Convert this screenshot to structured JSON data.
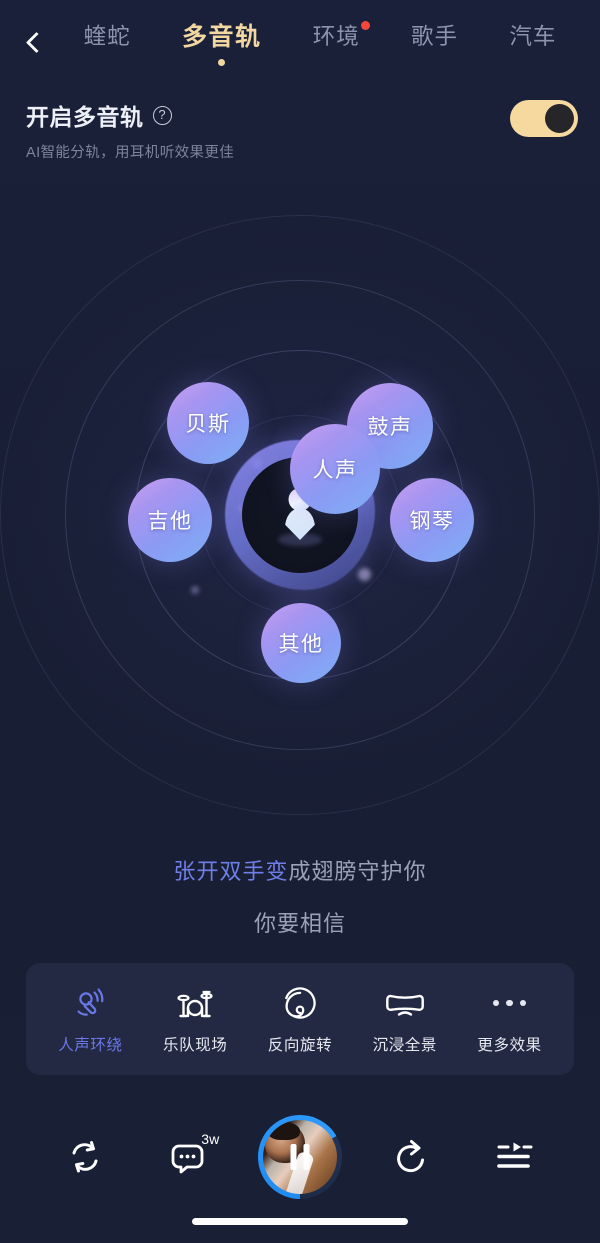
{
  "header": {
    "back_icon": "chevron-left-icon",
    "tabs": [
      {
        "label": "蝰蛇",
        "active": false,
        "badge": false
      },
      {
        "label": "多音轨",
        "active": true,
        "badge": false
      },
      {
        "label": "环境",
        "active": false,
        "badge": true
      },
      {
        "label": "歌手",
        "active": false,
        "badge": false
      },
      {
        "label": "汽车",
        "active": false,
        "badge": false
      }
    ],
    "active_color": "#f3d7a0",
    "inactive_color": "#8c93ad",
    "badge_color": "#f4473c"
  },
  "enable_section": {
    "title": "开启多音轨",
    "help_icon": "question-mark-icon",
    "help_glyph": "?",
    "subtitle": "AI智能分轨，用耳机听效果更佳",
    "toggle_on": true,
    "toggle_color": "#f5d99e"
  },
  "visualizer": {
    "center_avatar": "listener-avatar-icon",
    "tracks": [
      {
        "id": "bass",
        "label": "贝斯"
      },
      {
        "id": "drums",
        "label": "鼓声"
      },
      {
        "id": "vocal",
        "label": "人声"
      },
      {
        "id": "guitar",
        "label": "吉他"
      },
      {
        "id": "piano",
        "label": "钢琴"
      },
      {
        "id": "other",
        "label": "其他"
      }
    ],
    "bubble_color": "#8b9af4"
  },
  "lyrics": {
    "line1_highlighted": "张开双手变",
    "line1_rest": "成翅膀守护你",
    "line2": "你要相信",
    "highlight_color": "#6f7fe8",
    "dim_color": "#9ba2b8"
  },
  "effects": {
    "items": [
      {
        "label": "人声环绕",
        "icon": "microphone-surround-icon",
        "active": true
      },
      {
        "label": "乐队现场",
        "icon": "drum-kit-icon",
        "active": false
      },
      {
        "label": "反向旋转",
        "icon": "spiral-icon",
        "active": false
      },
      {
        "label": "沉浸全景",
        "icon": "vr-headset-icon",
        "active": false
      },
      {
        "label": "更多效果",
        "icon": "more-dots-icon",
        "active": false
      }
    ],
    "active_color": "#6a77e6",
    "panel_color": "#232943"
  },
  "player_bar": {
    "loop_icon": "repeat-icon",
    "comment_icon": "comment-icon",
    "comment_count": "3w",
    "album_icon": "album-art-play-toggle",
    "playing": true,
    "pause_icon": "pause-icon",
    "share_icon": "share-icon",
    "playlist_icon": "playlist-icon",
    "progress_color": "#2f9bff"
  },
  "system": {
    "home_indicator": "home-indicator-bar"
  }
}
